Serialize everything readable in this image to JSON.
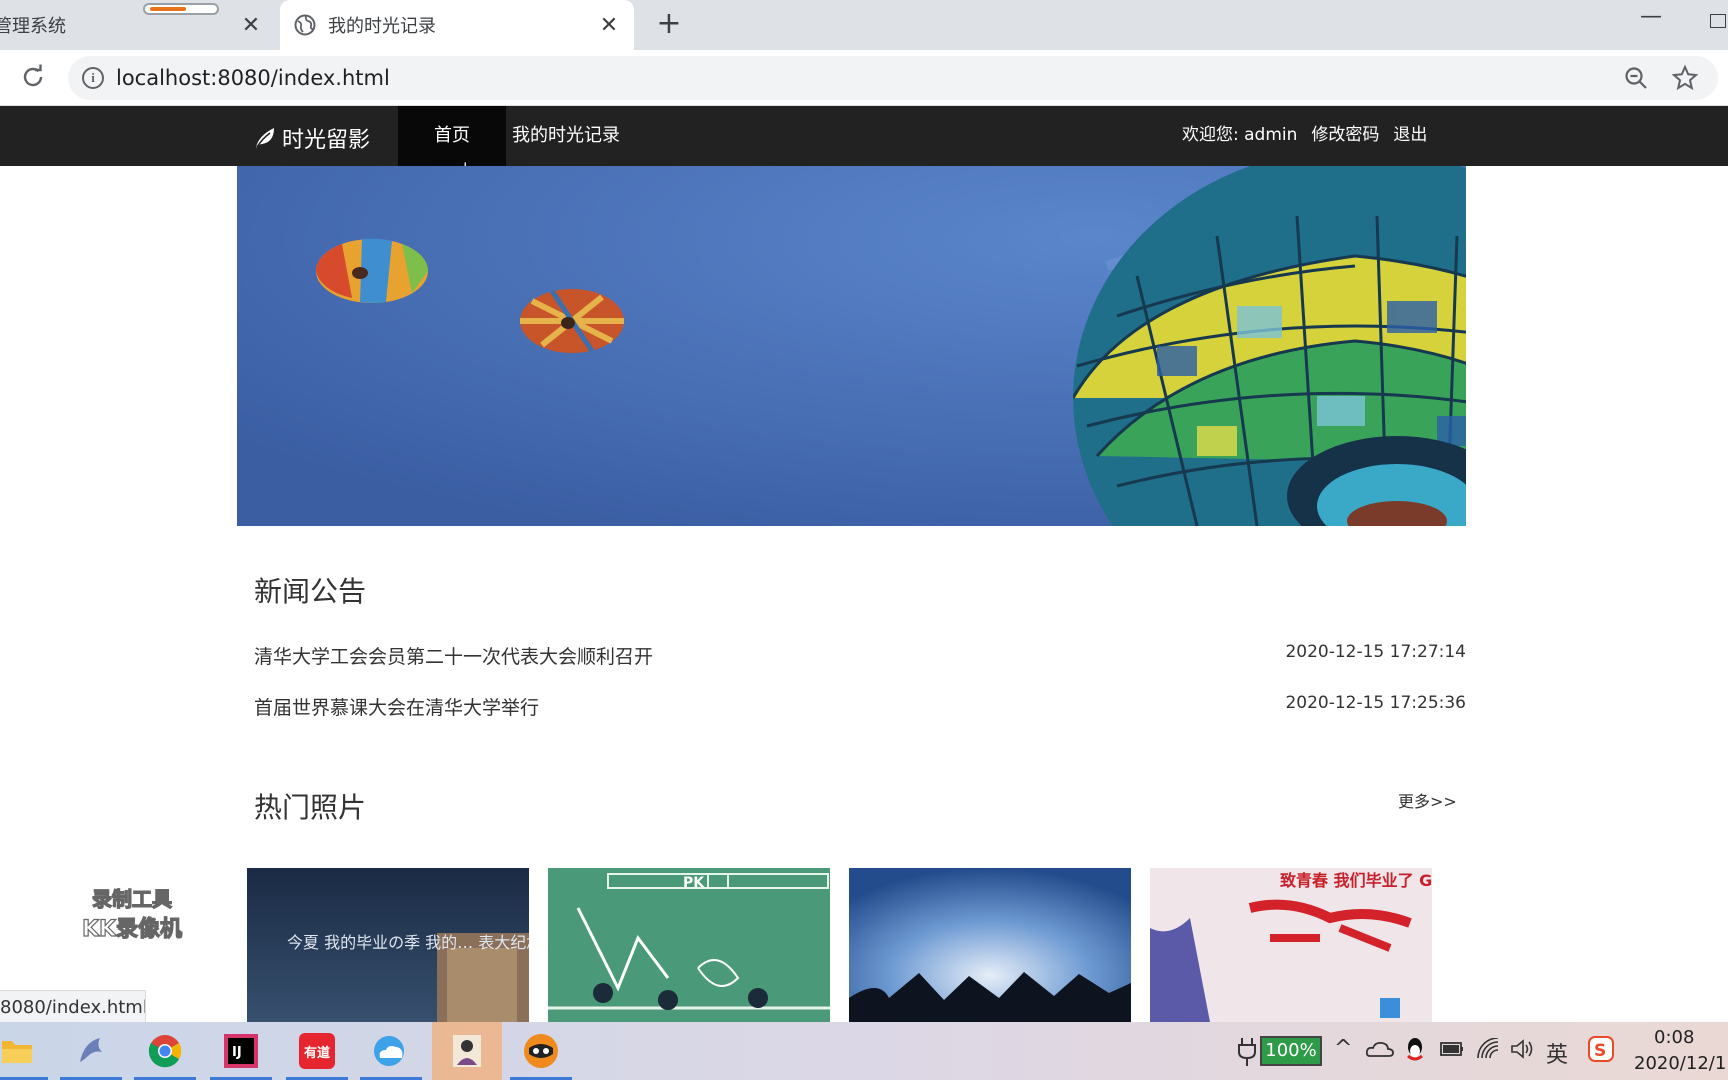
{
  "browser": {
    "tabs": [
      {
        "title": "管理系统"
      },
      {
        "title": "我的时光记录"
      }
    ],
    "new_tab_label": "+",
    "close_glyph": "✕",
    "url": "localhost:8080/index.html",
    "status_url": "8080/index.html"
  },
  "nav": {
    "brand": "时光留影",
    "items": [
      {
        "label": "首页",
        "active": true
      },
      {
        "label": "我的时光记录",
        "active": false
      }
    ],
    "welcome": "欢迎您: admin",
    "change_password": "修改密码",
    "logout": "退出"
  },
  "news": {
    "title": "新闻公告",
    "items": [
      {
        "title": "清华大学工会会员第二十一次代表大会顺利召开",
        "date": "2020-12-15 17:27:14"
      },
      {
        "title": "首届世界慕课大会在清华大学举行",
        "date": "2020-12-15 17:25:36"
      }
    ]
  },
  "photos": {
    "title": "热门照片",
    "more": "更多>>",
    "items": [
      {
        "caption": "今夏 我的毕业の季 我的… 表大纪念…"
      },
      {
        "caption": "PK"
      },
      {
        "caption": ""
      },
      {
        "caption": "致青春 我们毕业了 GRADUAT"
      }
    ]
  },
  "watermark": {
    "line1": "录制工具",
    "line2": "KK录像机"
  },
  "taskbar": {
    "battery": "100%",
    "ime": "英",
    "time": "0:08",
    "date": "2020/12/1"
  },
  "colors": {
    "nav_bg": "#222222",
    "nav_active_bg": "#080808",
    "sky": "#4a74bb"
  }
}
